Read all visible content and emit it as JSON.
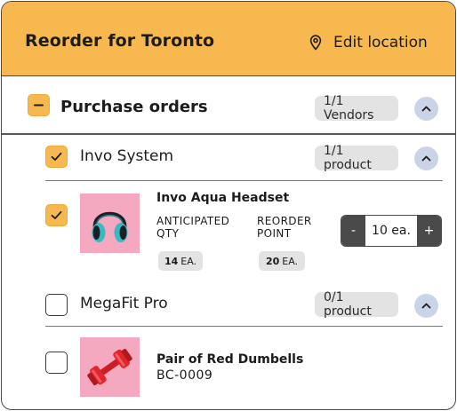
{
  "header": {
    "title": "Reorder for Toronto",
    "edit_location_label": "Edit location",
    "background_color": "#f7b94f",
    "location_icon": "map-pin-icon"
  },
  "purchase_orders": {
    "label": "Purchase orders",
    "count_badge": "1/1 Vendors",
    "checkbox_state": "indeterminate",
    "expanded": true
  },
  "vendors": [
    {
      "name": "Invo System",
      "count_badge": "1/1 product",
      "checked": true,
      "expanded": true,
      "products": [
        {
          "name": "Invo Aqua Headset",
          "checked": true,
          "image_icon": "headphones-icon",
          "anticipated_qty_label_1": "ANTICIPATED",
          "anticipated_qty_label_2": "QTY",
          "anticipated_qty_value": "14",
          "anticipated_qty_unit": "EA.",
          "reorder_point_label_1": "REORDER",
          "reorder_point_label_2": "POINT",
          "reorder_point_value": "20",
          "reorder_point_unit": "EA.",
          "stepper_minus": "-",
          "stepper_value": "10 ea.",
          "stepper_plus": "+"
        }
      ]
    },
    {
      "name": "MegaFit Pro",
      "count_badge": "0/1 product",
      "checked": false,
      "expanded": true,
      "products": [
        {
          "name": "Pair of Red Dumbells",
          "sku": "BC-0009",
          "checked": false,
          "image_icon": "dumbbell-icon"
        }
      ]
    }
  ],
  "colors": {
    "accent": "#f7b94f",
    "badge_bg": "#e3e3e3",
    "chevron_bg": "#c9d4e8",
    "thumb_bg": "#f4a9c1",
    "stepper_btn": "#4a4a4a"
  }
}
